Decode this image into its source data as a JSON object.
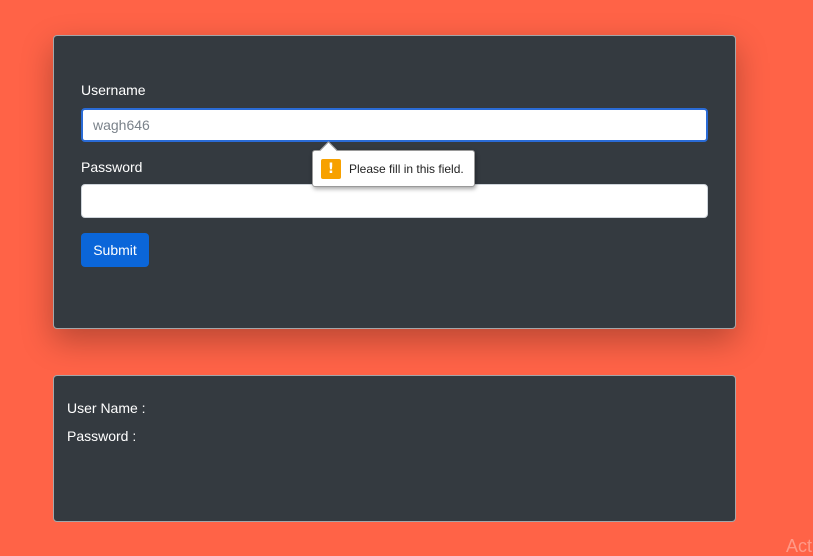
{
  "form": {
    "username_label": "Username",
    "username_placeholder": "wagh646",
    "username_value": "",
    "password_label": "Password",
    "password_value": "",
    "submit_label": "Submit"
  },
  "validation_tooltip": {
    "icon": "warning-icon",
    "icon_glyph": "!",
    "message": "Please fill in this field."
  },
  "output": {
    "username_label": "User Name :",
    "password_label": "Password :"
  },
  "watermark": {
    "text": "Act"
  },
  "colors": {
    "background": "#ff6347",
    "card": "#343a40",
    "submit_button": "#0b66d9",
    "warning_icon": "#f7a100"
  }
}
